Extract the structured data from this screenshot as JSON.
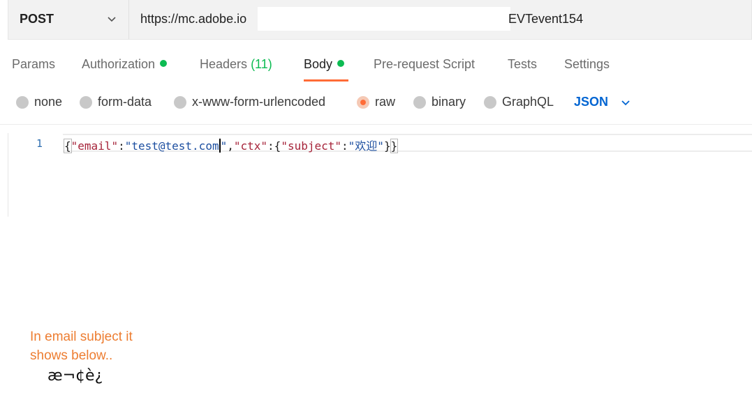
{
  "request": {
    "method": "POST",
    "url_visible_start": "https://mc.adobe.io",
    "url_visible_end": "EVTevent154"
  },
  "tabs": [
    {
      "label": "Params"
    },
    {
      "label": "Authorization",
      "dot": true
    },
    {
      "label": "Headers",
      "count": "(11)"
    },
    {
      "label": "Body",
      "dot": true,
      "active": true
    },
    {
      "label": "Pre-request Script"
    },
    {
      "label": "Tests"
    },
    {
      "label": "Settings"
    }
  ],
  "body_types": {
    "options": [
      "none",
      "form-data",
      "x-www-form-urlencoded",
      "raw",
      "binary",
      "GraphQL"
    ],
    "selected": "raw",
    "format": "JSON"
  },
  "editor": {
    "line_number": "1",
    "tokens": {
      "open": "{",
      "email_key": "\"email\"",
      "colon1": ":",
      "email_val": "\"test@test.com",
      "email_val_end": "\"",
      "comma": ",",
      "ctx_key": "\"ctx\"",
      "colon2": ":",
      "open2": "{",
      "subject_key": "\"subject\"",
      "colon3": ":",
      "subject_val": "\"欢迎\"",
      "close2": "}",
      "close": "}"
    }
  },
  "note": {
    "text": "In email subject it shows below..",
    "garbled": "æ¬¢è¿"
  },
  "colors": {
    "accent": "#ff6c37",
    "status_dot": "#0cbb52",
    "json_link": "#0265d2",
    "note": "#ed7d31"
  }
}
